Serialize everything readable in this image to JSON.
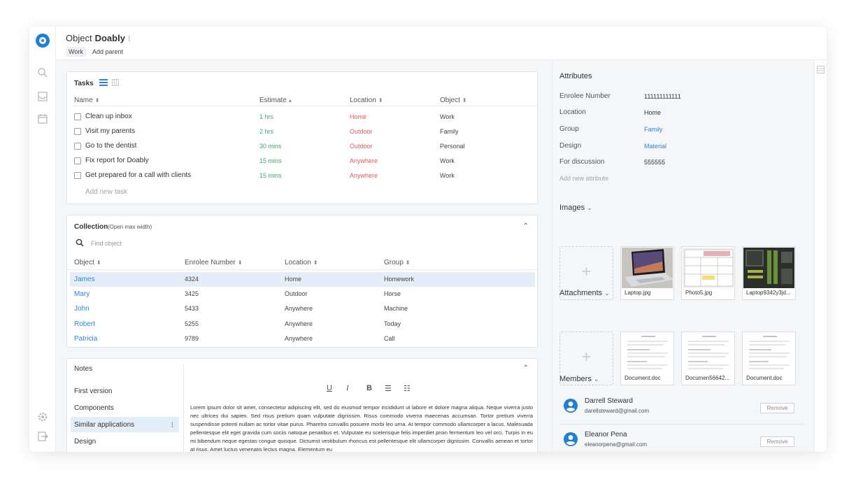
{
  "header": {
    "title_prefix": "Object",
    "title_name": "Doably",
    "more_glyph": "⁝",
    "tag_work": "Work",
    "add_parent": "Add parent"
  },
  "tasks": {
    "title": "Tasks",
    "columns": [
      "Name",
      "Estimate",
      "Location",
      "Object"
    ],
    "sort_glyphs": [
      "⬍",
      "▴",
      "⬍",
      "⬍"
    ],
    "rows": [
      {
        "name": "Clean up inbox",
        "estimate": "1 hrs",
        "location": "Home",
        "object": "Work"
      },
      {
        "name": "Visit my parents",
        "estimate": "2 hrs",
        "location": "Outdoor",
        "object": "Family"
      },
      {
        "name": "Go to the dentist",
        "estimate": "30 mins",
        "location": "Outdoor",
        "object": "Personal"
      },
      {
        "name": "Fix report for Doably",
        "estimate": "15 mins",
        "location": "Anywhere",
        "object": "Work"
      },
      {
        "name": "Get prepared for a call with clients",
        "estimate": "15 mins",
        "location": "Anywhere",
        "object": "Work"
      }
    ],
    "add_label": "Add new task",
    "colors": {
      "estimate": "#3fa66e",
      "location": "#e05a5a"
    }
  },
  "collection": {
    "title": "Collection",
    "subtitle": "(Open max width)",
    "search_placeholder": "Find object",
    "columns": [
      "Object",
      "Enrolee Number",
      "Location",
      "Group"
    ],
    "rows": [
      {
        "object": "James",
        "number": "4324",
        "location": "Home",
        "group": "Homework"
      },
      {
        "object": "Mary",
        "number": "3425",
        "location": "Outdoor",
        "group": "Horse"
      },
      {
        "object": "John",
        "number": "5433",
        "location": "Anywhere",
        "group": "Machine"
      },
      {
        "object": "Robert",
        "number": "5255",
        "location": "Anywhere",
        "group": "Today"
      },
      {
        "object": "Patricia",
        "number": "9789",
        "location": "Anywhere",
        "group": "Call"
      }
    ],
    "selected_row": 0,
    "collapse_glyph": "⌃"
  },
  "notes": {
    "title": "Notes",
    "items": [
      "First version",
      "Components",
      "Similar applications",
      "Design"
    ],
    "selected_item": 2,
    "format_buttons": [
      "U",
      "I",
      "B",
      "☰",
      "☷"
    ],
    "body": "Lorem ipsum dolor sit amet, consectetur adipiscing elit, sed do eiusmod tempor incididunt ut labore et dolore magna aliqua. Neque viverra justo nec ultrices dui sapien. Sed risus pretium quam vulputate dignissim. Risus commodo viverra maecenas accumsan. Tortor pretium viverra suspendisse potenti nullam ac tortor vitae purus. Pharetra convallis posuere morbi leo urna. At tempor commodo ullamcorper a lacus. Malesuada pellentesque elit eget gravida cum sociis natoque penatibus et. Vulputate eu scelerisque felis imperdiet proin fermentum leo vel orci. Turpis in eu mi bibendum neque egestas congue quisque. Dictumst vestibulum rhoncus est pellentesque elit ullamcorper dignissim. Convallis aenean et tortor at risus. Amet luctus venenatis lectus magna. Elementum eu"
  },
  "attributes": {
    "title": "Attributes",
    "rows": [
      {
        "label": "Enrolee Number",
        "value": "111111111111",
        "link": false
      },
      {
        "label": "Location",
        "value": "Home",
        "link": false
      },
      {
        "label": "Group",
        "value": "Family",
        "link": true
      },
      {
        "label": "Design",
        "value": "Material",
        "link": true
      },
      {
        "label": "For discussion",
        "value": "555555",
        "link": false
      }
    ],
    "add_label": "Add new attribute"
  },
  "images": {
    "title": "Images",
    "files": [
      "Laptop.jpg",
      "Photo5.jpg",
      "Laptop9342y3jd..."
    ]
  },
  "attachments": {
    "title": "Attachments",
    "files": [
      "Document.doc",
      "Documen56642...",
      "Document.doc"
    ]
  },
  "members": {
    "title": "Members",
    "people": [
      {
        "name": "Darrell Steward",
        "email": "darellsteward@gmail.com",
        "action": "Remove"
      },
      {
        "name": "Eleanor Pena",
        "email": "eleanorpena@gmail.com",
        "action": "Remove"
      }
    ],
    "avatar_color": "#1e7fd8"
  },
  "chevron_glyph": "⌄",
  "add_glyph": "+",
  "accent_color": "#2e86d9"
}
